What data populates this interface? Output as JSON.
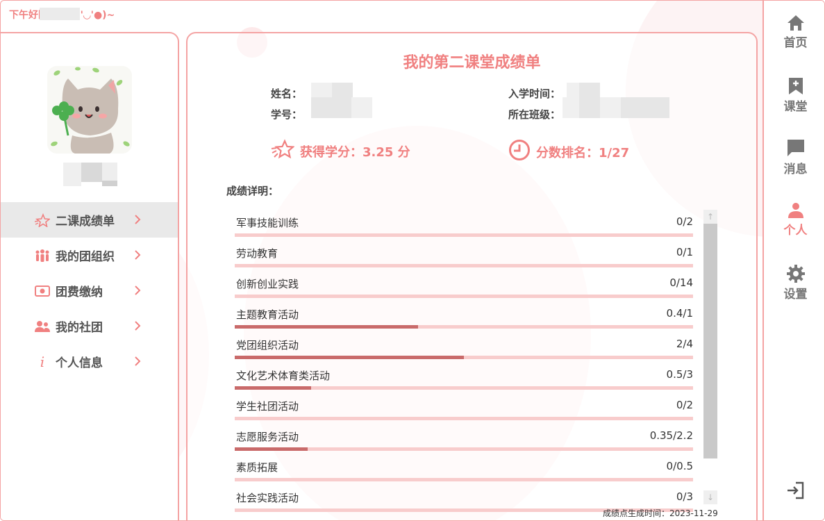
{
  "greeting": {
    "prefix": "下午好",
    "suffix": "同学！(●'◡'●)~"
  },
  "sidebar": {
    "menu": [
      {
        "label": "二课成绩单",
        "icon": "star-sparkle-icon",
        "active": true
      },
      {
        "label": "我的团组织",
        "icon": "people-group-icon",
        "active": false
      },
      {
        "label": "团费缴纳",
        "icon": "banknote-icon",
        "active": false
      },
      {
        "label": "我的社团",
        "icon": "community-icon",
        "active": false
      },
      {
        "label": "个人信息",
        "icon": "info-icon",
        "active": false
      }
    ]
  },
  "report": {
    "title": "我的第二课堂成绩单",
    "name_label": "姓名：",
    "id_label": "学号：",
    "enroll_label": "入学时间：",
    "class_label": "所在班级：",
    "credits": "获得学分：3.25 分",
    "rank": "分数排名：1/27",
    "detail_label": "成绩详明：",
    "items": [
      {
        "name": "军事技能训练",
        "value": "0/2",
        "fraction": 0
      },
      {
        "name": "劳动教育",
        "value": "0/1",
        "fraction": 0
      },
      {
        "name": "创新创业实践",
        "value": "0/14",
        "fraction": 0
      },
      {
        "name": "主题教育活动",
        "value": "0.4/1",
        "fraction": 0.4
      },
      {
        "name": "党团组织活动",
        "value": "2/4",
        "fraction": 0.5
      },
      {
        "name": "文化艺术体育类活动",
        "value": "0.5/3",
        "fraction": 0.1667
      },
      {
        "name": "学生社团活动",
        "value": "0/2",
        "fraction": 0
      },
      {
        "name": "志愿服务活动",
        "value": "0.35/2.2",
        "fraction": 0.159
      },
      {
        "name": "素质拓展",
        "value": "0/0.5",
        "fraction": 0
      },
      {
        "name": "社会实践活动",
        "value": "0/3",
        "fraction": 0
      }
    ],
    "generated": "成绩点生成时间：2023-11-29"
  },
  "nav": [
    {
      "label": "首页",
      "icon": "home-icon"
    },
    {
      "label": "课堂",
      "icon": "bookmark-add-icon"
    },
    {
      "label": "消息",
      "icon": "message-icon"
    },
    {
      "label": "个人",
      "icon": "person-icon",
      "active": true
    },
    {
      "label": "设置",
      "icon": "gear-icon"
    }
  ],
  "colors": {
    "accent": "#f08080",
    "border": "#f4a3a3",
    "progress_fill": "#c96a6a",
    "progress_track": "#f8cccc"
  }
}
